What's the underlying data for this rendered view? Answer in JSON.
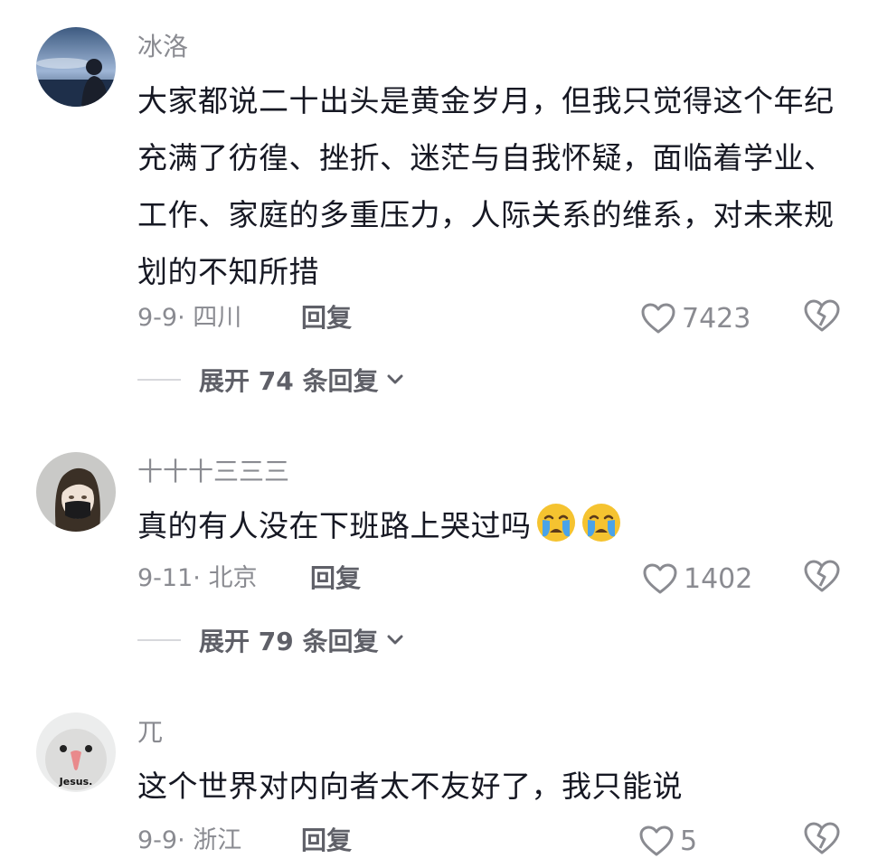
{
  "comments": [
    {
      "username": "冰洛",
      "text": "大家都说二十出头是黄金岁月，但我只觉得这个年纪充满了彷徨、挫折、迷茫与自我怀疑，面临着学业、工作、家庭的多重压力，人际关系的维系，对未来规划的不知所措",
      "date": "9-9",
      "location": "四川",
      "reply_label": "回复",
      "likes": "7423",
      "expand_label": "展开 74 条回复",
      "avatar_icon": "night-sky-portrait-avatar"
    },
    {
      "username": "十十十三三三",
      "text": "真的有人没在下班路上哭过吗",
      "emojis": [
        "crying-face-emoji",
        "crying-face-emoji"
      ],
      "date": "9-11",
      "location": "北京",
      "reply_label": "回复",
      "likes": "1402",
      "expand_label": "展开 79 条回复",
      "avatar_icon": "masked-girl-illustration-avatar"
    },
    {
      "username": "兀",
      "text": "这个世界对内向者太不友好了，我只能说",
      "date": "9-9",
      "location": "浙江",
      "reply_label": "回复",
      "likes": "5",
      "avatar_icon": "bird-jesus-meme-avatar",
      "avatar_text": "Jesus."
    }
  ],
  "colors": {
    "text": "#161823",
    "muted": "#8a8b91",
    "bold_muted": "#5f6068",
    "emoji_face": "#f5c330"
  }
}
